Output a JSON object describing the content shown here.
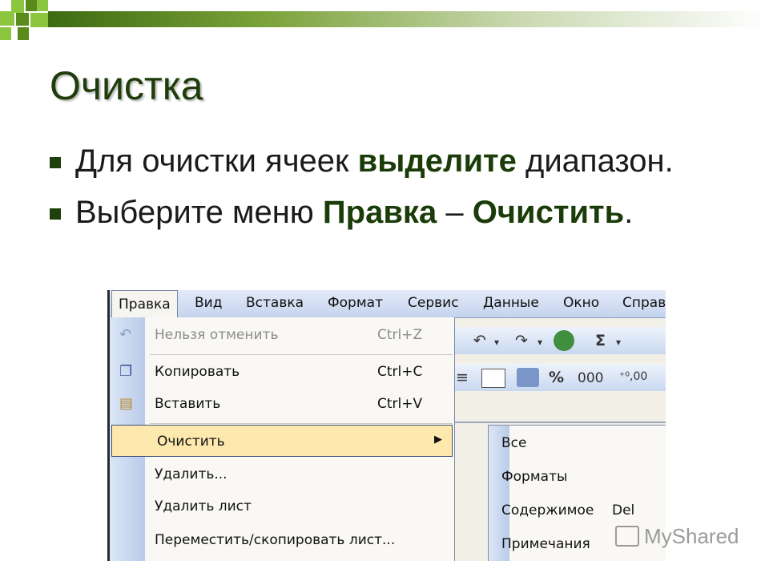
{
  "slide": {
    "title": "Очистка",
    "bullet1": {
      "part1": "Для очистки ячеек ",
      "bold": "выделите",
      "part2": " диапазон."
    },
    "bullet2": {
      "part1": "Выберите меню ",
      "bold1": "Правка",
      "dash": " – ",
      "bold2": "Очистить",
      "end": "."
    }
  },
  "menubar": {
    "items": [
      "Правка",
      "Вид",
      "Вставка",
      "Формат",
      "Сервис",
      "Данные",
      "Окно",
      "Справ"
    ]
  },
  "edit_menu": {
    "items": [
      {
        "label": "Нельзя отменить",
        "shortcut": "Ctrl+Z",
        "icon": "undo-icon"
      },
      {
        "label": "Копировать",
        "shortcut": "Ctrl+C",
        "icon": "copy-icon"
      },
      {
        "label": "Вставить",
        "shortcut": "Ctrl+V",
        "icon": "paste-icon"
      },
      {
        "label": "Очистить",
        "shortcut": "",
        "icon": ""
      },
      {
        "label": "Удалить...",
        "shortcut": "",
        "icon": ""
      },
      {
        "label": "Удалить лист",
        "shortcut": "",
        "icon": ""
      },
      {
        "label": "Переместить/скопировать лист...",
        "shortcut": "",
        "icon": ""
      }
    ]
  },
  "clear_submenu": {
    "items": [
      {
        "label": "Все",
        "shortcut": ""
      },
      {
        "label": "Форматы",
        "shortcut": ""
      },
      {
        "label": "Содержимое",
        "shortcut": "Del"
      },
      {
        "label": "Примечания",
        "shortcut": ""
      }
    ]
  },
  "toolbar": {
    "row1": [
      "↶",
      "▾",
      "↷",
      "▾",
      "Σ",
      "▾"
    ],
    "row2": [
      "≡",
      "%",
      "000"
    ]
  },
  "watermark": "MyShared",
  "colors": {
    "accent_green": "#8cc63f",
    "title_green": "#1e3d0a",
    "highlight": "#fde9ad"
  }
}
